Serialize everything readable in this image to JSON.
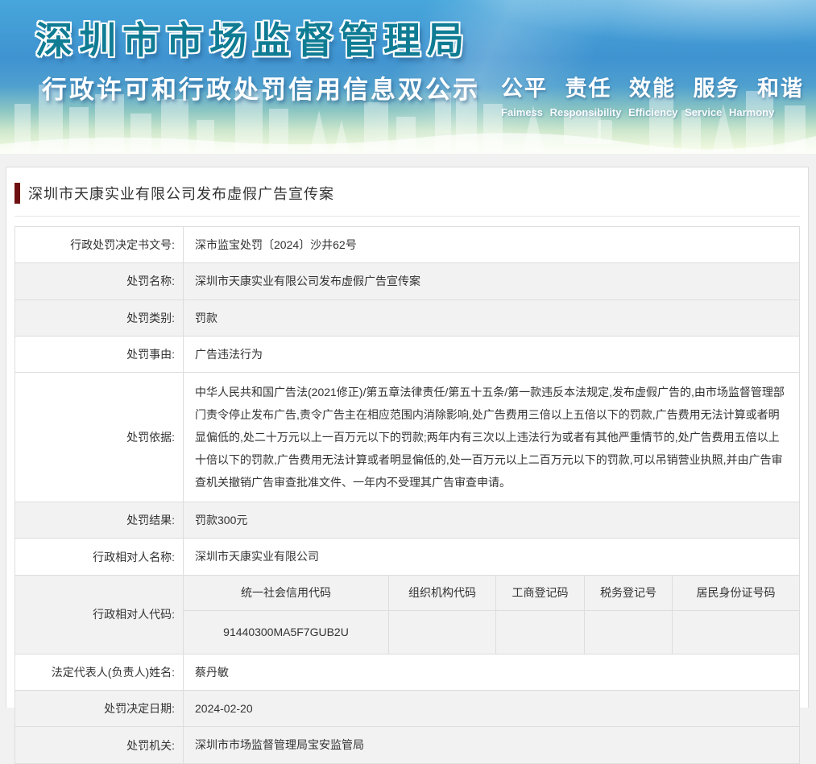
{
  "banner": {
    "title": "深圳市市场监督管理局",
    "subtitle": "行政许可和行政处罚信用信息双公示",
    "slogan_cn": "公平 责任 效能 服务 和谐",
    "slogan_en": "Faimess Responsibility Efficiency Service Harmony",
    "colors": {
      "title_teal": "#0f7c94",
      "top_blue": "#3f93d0",
      "bottom_green": "#f4fae9"
    }
  },
  "page": {
    "case_title": "深圳市天康实业有限公司发布虚假广告宣传案",
    "accent_color": "#6e1011"
  },
  "table": {
    "rows": [
      {
        "type": "simple",
        "label": "行政处罚决定书文号:",
        "value": "深市监宝处罚〔2024〕沙井62号",
        "bg": "white"
      },
      {
        "type": "simple",
        "label": "处罚名称:",
        "value": "深圳市天康实业有限公司发布虚假广告宣传案",
        "bg": "gray"
      },
      {
        "type": "simple",
        "label": "处罚类别:",
        "value": "罚款",
        "bg": "gray"
      },
      {
        "type": "simple",
        "label": "处罚事由:",
        "value": "广告违法行为",
        "bg": "white"
      },
      {
        "type": "simple",
        "tall": true,
        "label": "处罚依据:",
        "value": "中华人民共和国广告法(2021修正)/第五章法律责任/第五十五条/第一款违反本法规定,发布虚假广告的,由市场监督管理部门责令停止发布广告,责令广告主在相应范围内消除影响,处广告费用三倍以上五倍以下的罚款,广告费用无法计算或者明显偏低的,处二十万元以上一百万元以下的罚款;两年内有三次以上违法行为或者有其他严重情节的,处广告费用五倍以上十倍以下的罚款,广告费用无法计算或者明显偏低的,处一百万元以上二百万元以下的罚款,可以吊销营业执照,并由广告审查机关撤销广告审查批准文件、一年内不受理其广告审查申请。",
        "bg": "white"
      },
      {
        "type": "simple",
        "label": "处罚结果:",
        "value": "罚款300元",
        "bg": "gray"
      },
      {
        "type": "simple",
        "label": "行政相对人名称:",
        "value": "深圳市天康实业有限公司",
        "bg": "white"
      },
      {
        "type": "code",
        "label": "行政相对人代码:",
        "bg": "gray",
        "columns": [
          "统一社会信用代码",
          "组织机构代码",
          "工商登记码",
          "税务登记号",
          "居民身份证号码"
        ],
        "values": [
          "91440300MA5F7GUB2U",
          "",
          "",
          "",
          ""
        ]
      },
      {
        "type": "simple",
        "label": "法定代表人(负责人)姓名:",
        "value": "蔡丹敏",
        "bg": "white"
      },
      {
        "type": "simple",
        "label": "处罚决定日期:",
        "value": "2024-02-20",
        "bg": "gray"
      },
      {
        "type": "simple",
        "label": "处罚机关:",
        "value": "深圳市市场监督管理局宝安监管局",
        "bg": "gray"
      }
    ]
  }
}
